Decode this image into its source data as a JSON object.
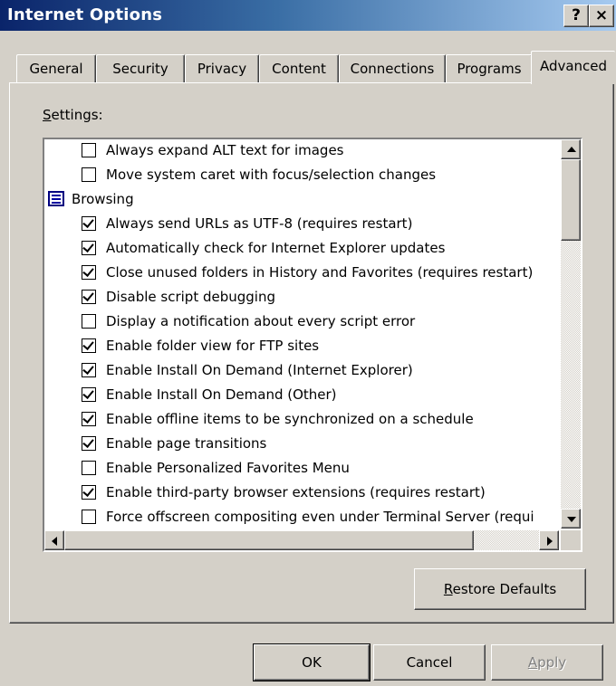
{
  "window": {
    "title": "Internet Options",
    "help_button": "?",
    "close_button": "×"
  },
  "tabs": [
    {
      "label": "General"
    },
    {
      "label": "Security"
    },
    {
      "label": "Privacy"
    },
    {
      "label": "Content"
    },
    {
      "label": "Connections"
    },
    {
      "label": "Programs"
    },
    {
      "label": "Advanced",
      "selected": true
    }
  ],
  "settings": {
    "label_prefix": "S",
    "label_rest": "ettings:",
    "items": [
      {
        "type": "checkbox",
        "label": "Always expand ALT text for images",
        "checked": false
      },
      {
        "type": "checkbox",
        "label": "Move system caret with focus/selection changes",
        "checked": false
      },
      {
        "type": "category",
        "label": "Browsing",
        "icon": "category-icon"
      },
      {
        "type": "checkbox",
        "label": "Always send URLs as UTF-8 (requires restart)",
        "checked": true
      },
      {
        "type": "checkbox",
        "label": "Automatically check for Internet Explorer updates",
        "checked": true
      },
      {
        "type": "checkbox",
        "label": "Close unused folders in History and Favorites (requires restart)",
        "checked": true
      },
      {
        "type": "checkbox",
        "label": "Disable script debugging",
        "checked": true
      },
      {
        "type": "checkbox",
        "label": "Display a notification about every script error",
        "checked": false
      },
      {
        "type": "checkbox",
        "label": "Enable folder view for FTP sites",
        "checked": true
      },
      {
        "type": "checkbox",
        "label": "Enable Install On Demand (Internet Explorer)",
        "checked": true
      },
      {
        "type": "checkbox",
        "label": "Enable Install On Demand (Other)",
        "checked": true
      },
      {
        "type": "checkbox",
        "label": "Enable offline items to be synchronized on a schedule",
        "checked": true
      },
      {
        "type": "checkbox",
        "label": "Enable page transitions",
        "checked": true
      },
      {
        "type": "checkbox",
        "label": "Enable Personalized Favorites Menu",
        "checked": false
      },
      {
        "type": "checkbox",
        "label": "Enable third-party browser extensions (requires restart)",
        "checked": true
      },
      {
        "type": "checkbox",
        "label": "Force offscreen compositing even under Terminal Server (requi",
        "checked": false
      }
    ]
  },
  "buttons": {
    "restore_prefix": "R",
    "restore_rest": "estore Defaults",
    "ok": "OK",
    "cancel": "Cancel",
    "apply_prefix": "A",
    "apply_rest": "pply",
    "apply_enabled": false
  },
  "colors": {
    "face": "#d4d0c8",
    "title_start": "#0a246a",
    "title_end": "#a6caf0"
  }
}
